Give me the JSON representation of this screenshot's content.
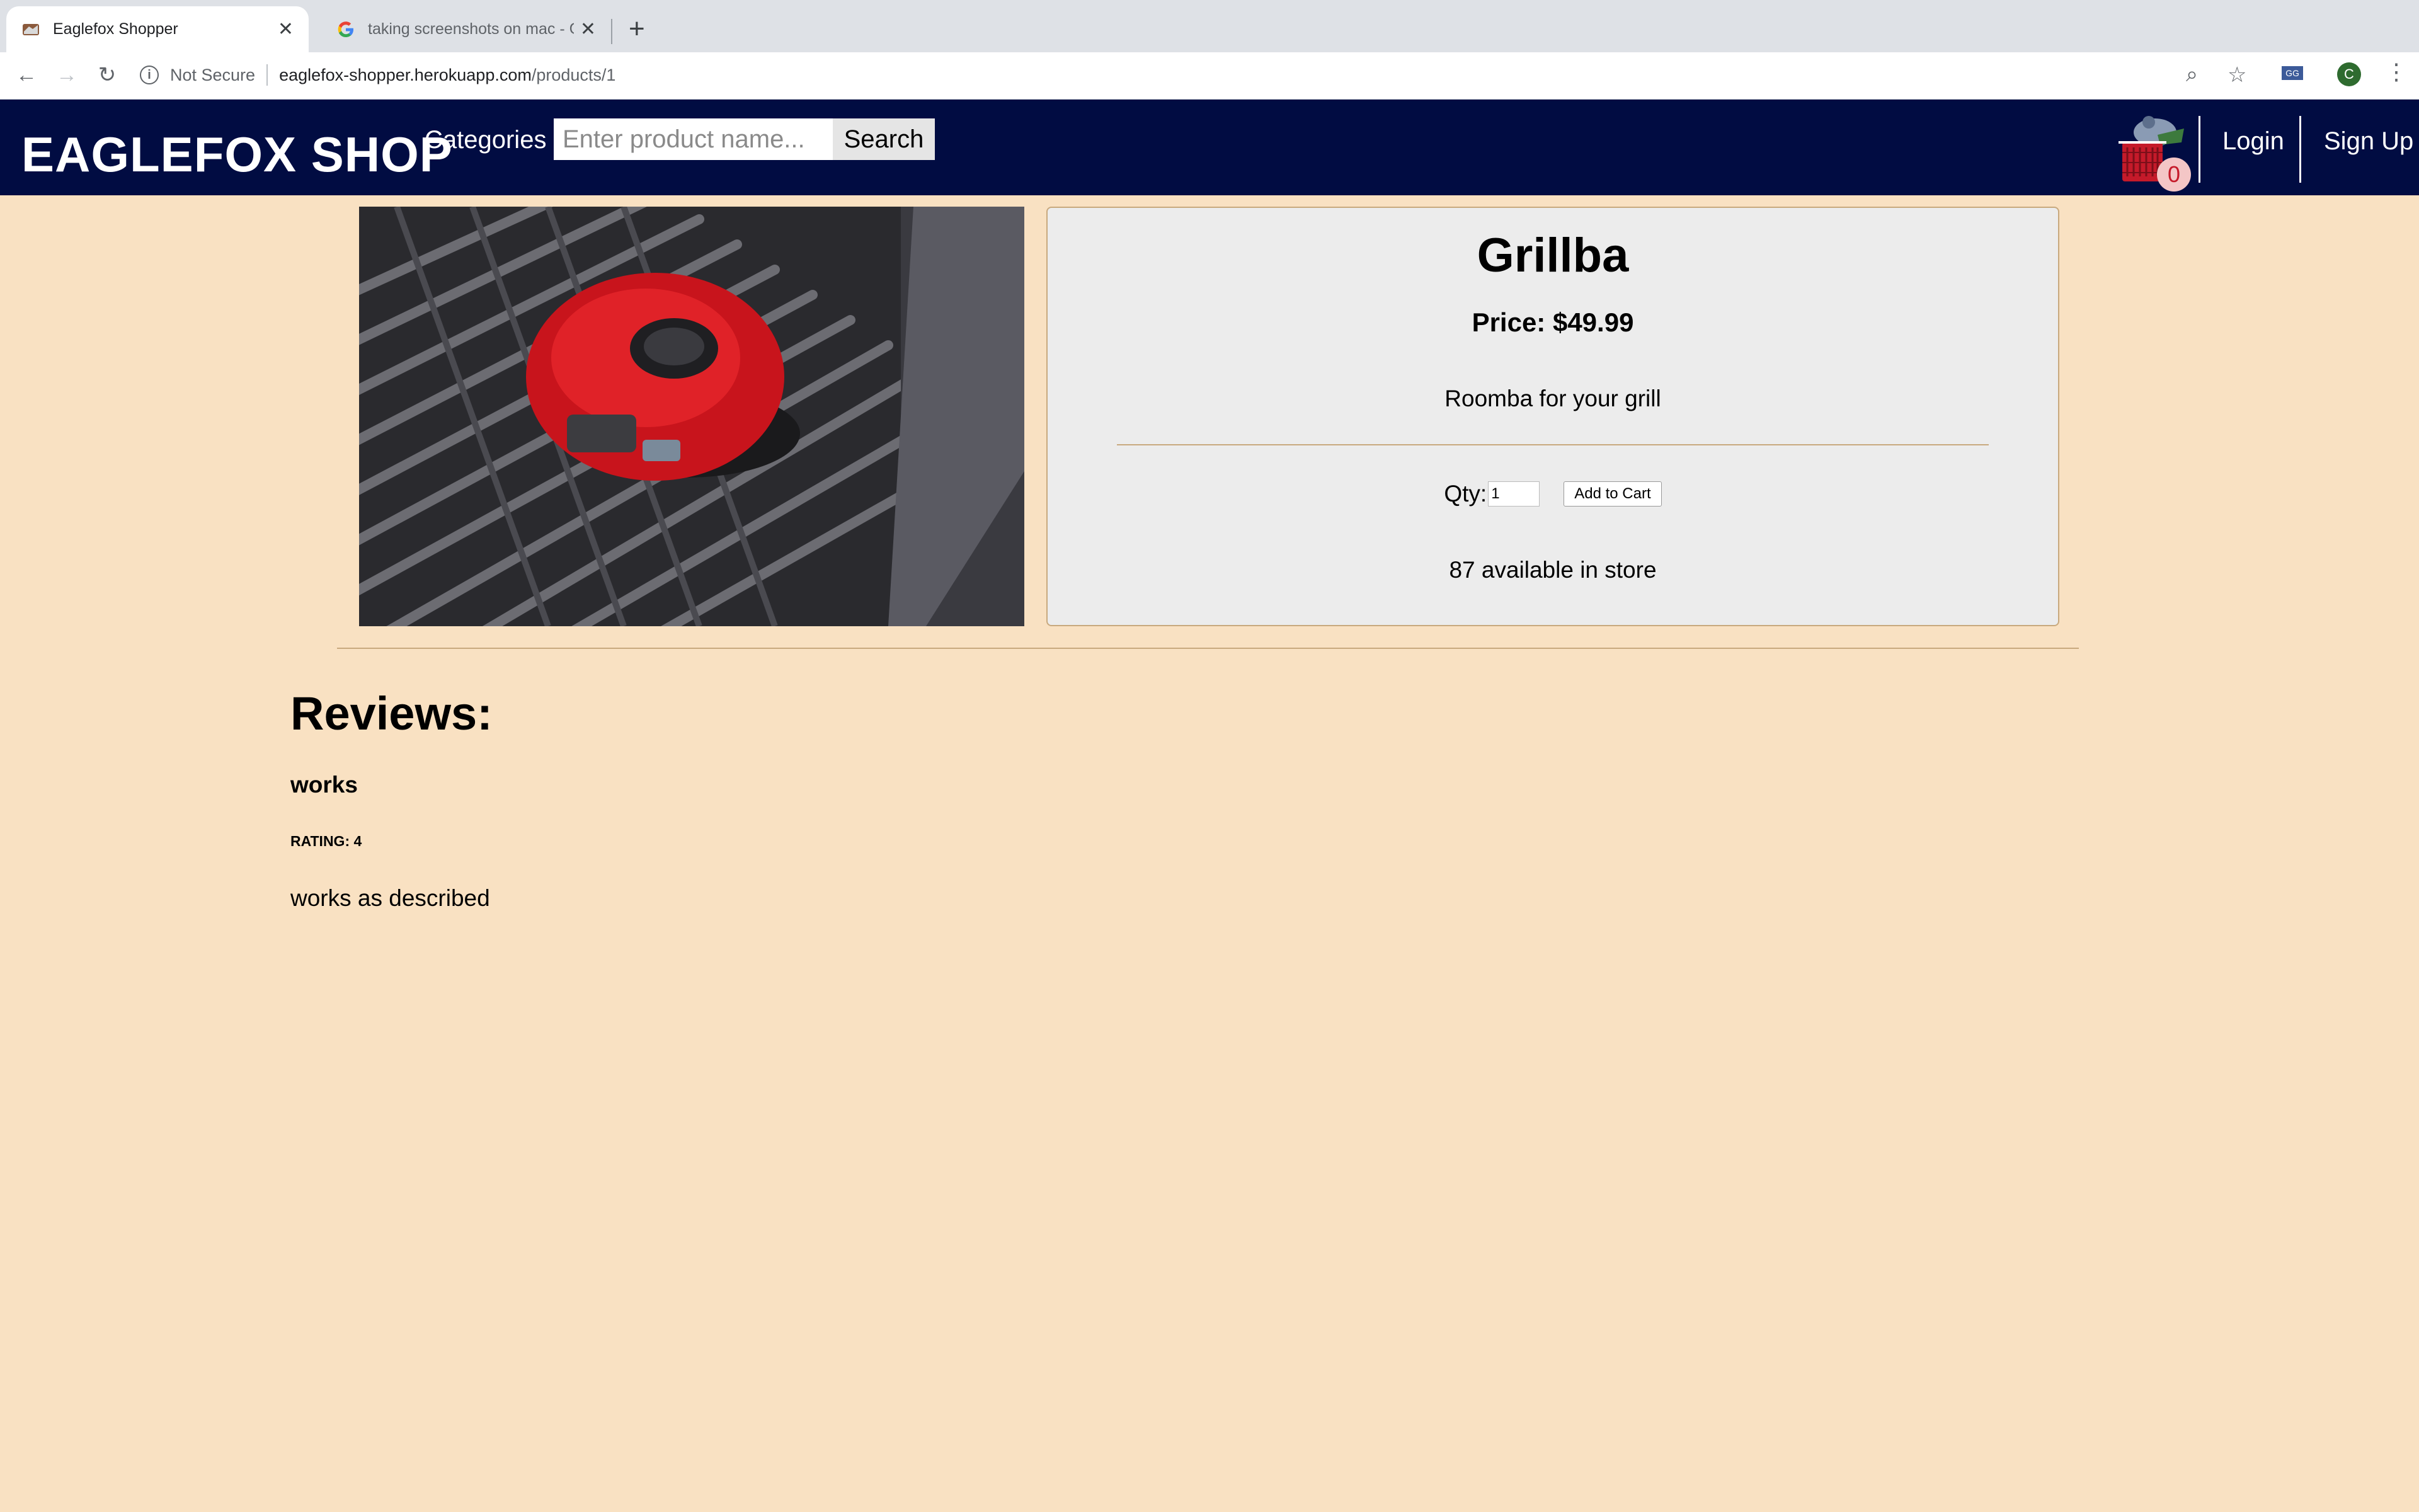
{
  "browser": {
    "tabs": [
      {
        "title": "Eaglefox Shopper",
        "active": true
      },
      {
        "title": "taking screenshots on mac - G",
        "active": false
      }
    ],
    "address": {
      "security": "Not Secure",
      "host": "eaglefox-shopper.herokuapp.com",
      "path": "/products/1"
    },
    "profile_initial": "C",
    "extension_label": "GG"
  },
  "site": {
    "brand": "EAGLEFOX SHOP",
    "categories_label": "Categories",
    "search": {
      "placeholder": "Enter product name...",
      "button_label": "Search"
    },
    "cart_count": "0",
    "login_label": "Login",
    "signup_label": "Sign Up",
    "colors": {
      "nav_bg": "#010c42",
      "page_bg": "#f9e1c2",
      "card_bg": "#ececec",
      "accent_border": "#c8a97e"
    }
  },
  "product": {
    "name": "Grillba",
    "price_text": "Price: $49.99",
    "description": "Roomba for your grill",
    "qty_label": "Qty:",
    "qty_value": "1",
    "add_to_cart_label": "Add to Cart",
    "stock_text": "87 available in store",
    "image_icon": "grill-robot-image"
  },
  "reviews": {
    "heading": "Reviews:",
    "items": [
      {
        "title": "works",
        "rating_label": "RATING:",
        "rating": "4",
        "body": "works as described"
      }
    ]
  }
}
